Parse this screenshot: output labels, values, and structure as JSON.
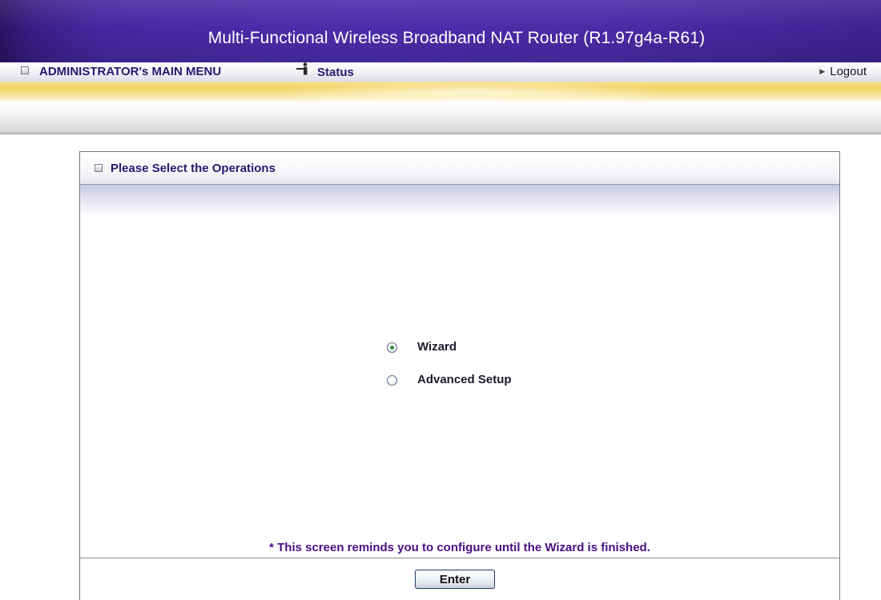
{
  "header": {
    "title": "Multi-Functional Wireless Broadband NAT Router (R1.97g4a-R61)"
  },
  "menu": {
    "main_menu_label": "ADMINISTRATOR's MAIN MENU",
    "status_label": "Status",
    "logout_label": "Logout"
  },
  "panel": {
    "title": "Please Select the Operations",
    "options": [
      {
        "label": "Wizard",
        "selected": true
      },
      {
        "label": "Advanced Setup",
        "selected": false
      }
    ],
    "reminder": "* This screen reminds you to configure until the Wizard is finished.",
    "enter_label": "Enter"
  },
  "colors": {
    "title_bar": "#4c2daa",
    "menu_text": "#241a6e",
    "reminder_text": "#4a0f82",
    "radio_selected": "#2f9b2f"
  }
}
